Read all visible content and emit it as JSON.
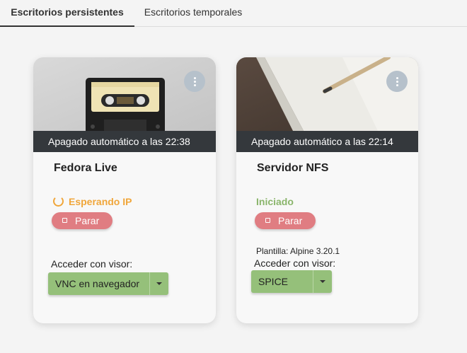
{
  "tabs": [
    {
      "label": "Escritorios persistentes",
      "active": true
    },
    {
      "label": "Escritorios temporales",
      "active": false
    }
  ],
  "desktops": [
    {
      "shutdown_text": "Apagado automático a las 22:38",
      "name": "Fedora Live",
      "status": "Esperando IP",
      "status_color": "#f0a63a",
      "stop_label": "Parar",
      "viewer_label": "Acceder con visor:",
      "viewer_value": "VNC en navegador",
      "thumbnail": "cassette-tape-image"
    },
    {
      "shutdown_text": "Apagado automático a las 22:14",
      "name": "Servidor NFS",
      "status": "Iniciado",
      "status_color": "#8ab56b",
      "stop_label": "Parar",
      "template": "Plantilla: Alpine 3.20.1",
      "viewer_label": "Acceder con visor:",
      "viewer_value": "SPICE",
      "thumbnail": "notebook-pencil-image"
    }
  ],
  "colors": {
    "shutdown_bar": "#34383c",
    "stop_button": "#e07d82",
    "viewer_button": "#95c07a",
    "menu_button": "#b6c1cb"
  }
}
